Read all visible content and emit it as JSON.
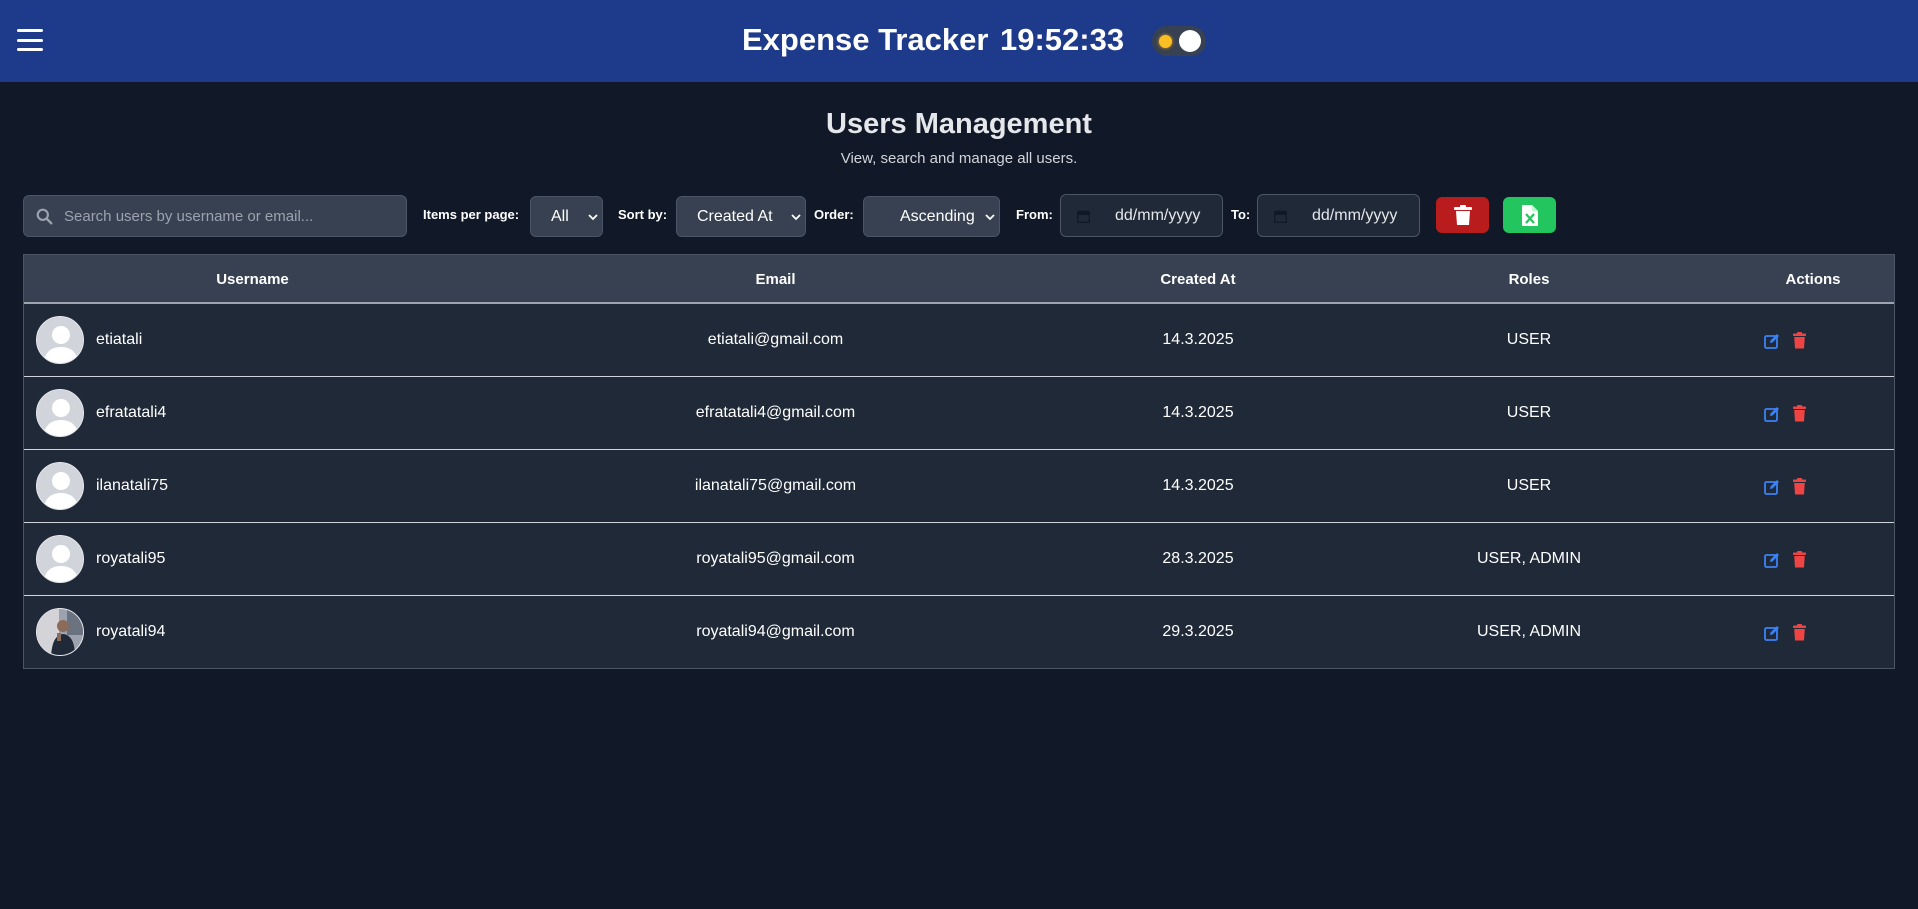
{
  "header": {
    "title": "Expense Tracker",
    "clock": "19:52:33"
  },
  "page": {
    "title": "Users Management",
    "subtitle": "View, search and manage all users."
  },
  "toolbar": {
    "search_placeholder": "Search users by username or email...",
    "items_per_page_label": "Items per page:",
    "items_per_page_value": "All",
    "sort_by_label": "Sort by:",
    "sort_by_value": "Created At",
    "order_label": "Order:",
    "order_value": "Ascending",
    "from_label": "From:",
    "from_value": "dd/mm/yyyy",
    "to_label": "To:",
    "to_value": "dd/mm/yyyy"
  },
  "colors": {
    "header_bg": "#1e3a8a",
    "page_bg": "#111827",
    "delete_button": "#b91c1c",
    "export_button": "#22c55e",
    "edit_icon": "#3b82f6",
    "delete_icon": "#ef4444"
  },
  "table": {
    "columns": [
      "Username",
      "Email",
      "Created At",
      "Roles",
      "Actions"
    ],
    "rows": [
      {
        "username": "etiatali",
        "email": "etiatali@gmail.com",
        "created_at": "14.3.2025",
        "roles": "USER",
        "avatar": "default-avatar-icon"
      },
      {
        "username": "efratatali4",
        "email": "efratatali4@gmail.com",
        "created_at": "14.3.2025",
        "roles": "USER",
        "avatar": "default-avatar-icon"
      },
      {
        "username": "ilanatali75",
        "email": "ilanatali75@gmail.com",
        "created_at": "14.3.2025",
        "roles": "USER",
        "avatar": "default-avatar-icon"
      },
      {
        "username": "royatali95",
        "email": "royatali95@gmail.com",
        "created_at": "28.3.2025",
        "roles": "USER, ADMIN",
        "avatar": "default-avatar-icon"
      },
      {
        "username": "royatali94",
        "email": "royatali94@gmail.com",
        "created_at": "29.3.2025",
        "roles": "USER, ADMIN",
        "avatar": "photo-avatar"
      }
    ]
  }
}
